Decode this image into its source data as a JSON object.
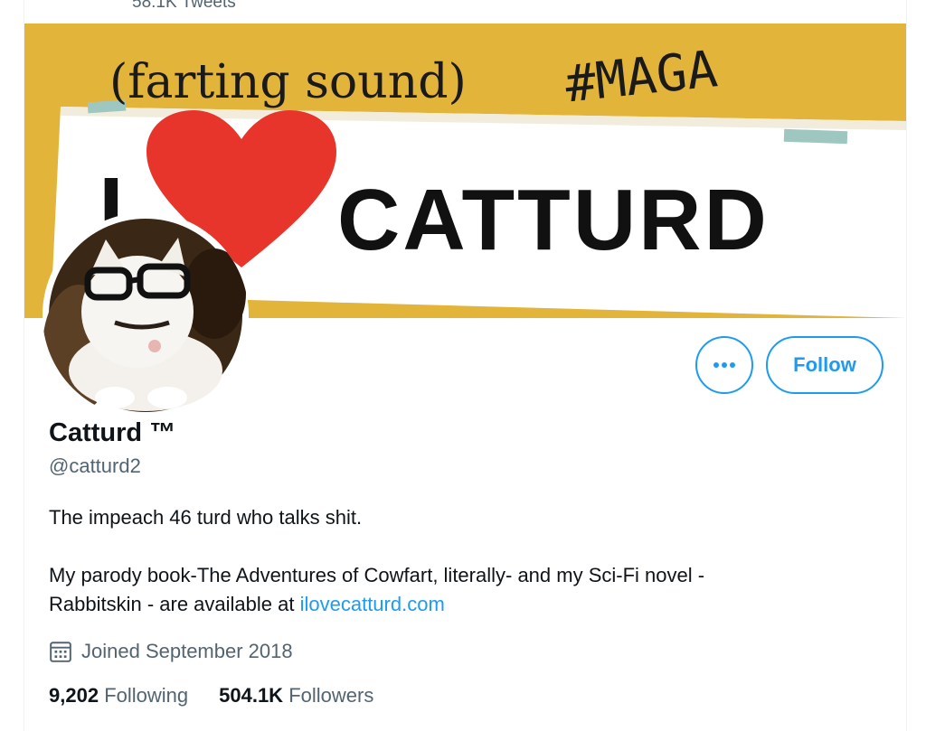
{
  "header": {
    "tweet_count": "58.1K Tweets"
  },
  "banner": {
    "caption": "(farting sound)",
    "hashtag": "#MAGA",
    "letter_i": "I",
    "brand": "CATTURD",
    "background_color": "#e2b43a",
    "heart_color": "#e8352b"
  },
  "profile": {
    "display_name": "Catturd ™",
    "handle": "@catturd2",
    "bio_line1": "The impeach 46 turd who talks shit.",
    "bio_line2": "My parody book-The Adventures of Cowfart, literally- and my Sci-Fi novel -",
    "bio_line3_prefix": "Rabbitskin - are available at ",
    "bio_link": "ilovecatturd.com",
    "joined": "Joined September 2018",
    "joined_icon": "calendar-icon"
  },
  "stats": {
    "following_count": "9,202",
    "following_label": "Following",
    "followers_count": "504.1K",
    "followers_label": "Followers"
  },
  "actions": {
    "more_icon": "more-dots-icon",
    "follow_label": "Follow",
    "accent_color": "#1d9bf0"
  }
}
